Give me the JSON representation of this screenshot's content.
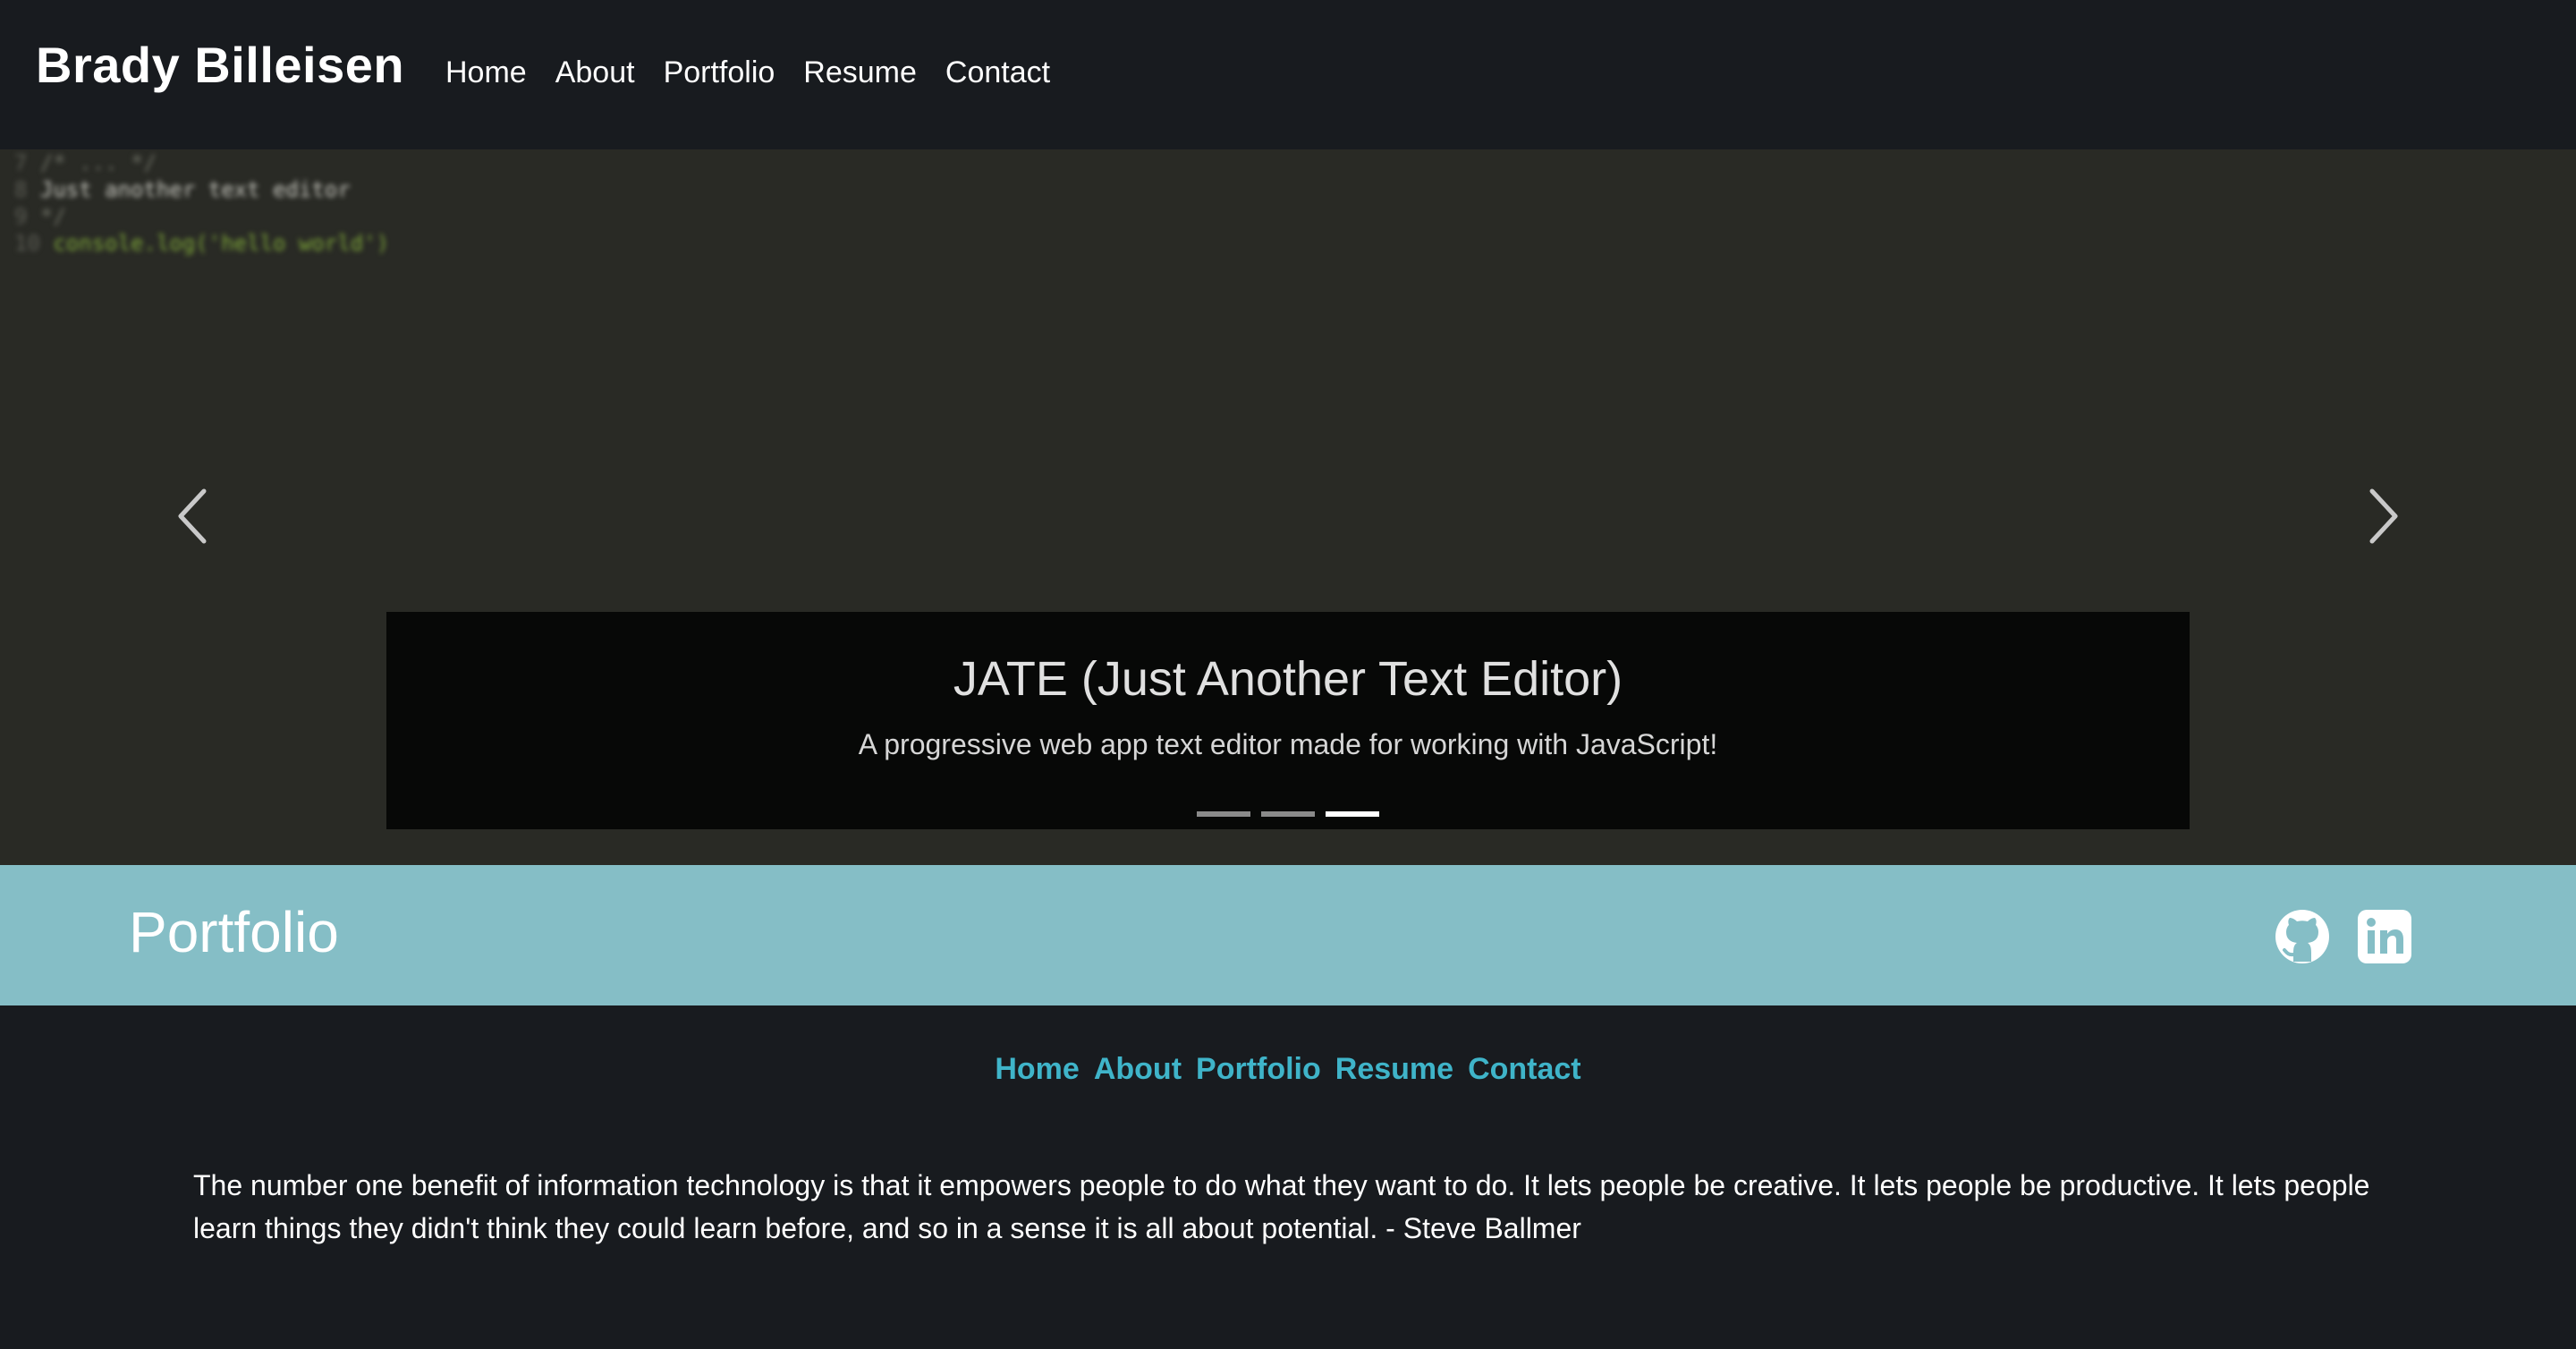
{
  "header": {
    "brand": "Brady Billeisen",
    "nav": [
      "Home",
      "About",
      "Portfolio",
      "Resume",
      "Contact"
    ]
  },
  "hero": {
    "code_lines": [
      {
        "num": "7",
        "text": "/* ... */"
      },
      {
        "num": "8",
        "text": "Just another text editor"
      },
      {
        "num": "9",
        "text": "*/"
      },
      {
        "num": "10",
        "text": "console.log('hello world')"
      }
    ],
    "slide": {
      "title": "JATE (Just Another Text Editor)",
      "description": "A progressive web app text editor made for working with JavaScript!"
    },
    "slide_count": 3,
    "active_slide": 3,
    "prev_icon": "chevron-left-icon",
    "next_icon": "chevron-right-icon"
  },
  "portfolio": {
    "title": "Portfolio",
    "social_icons": [
      "github-icon",
      "linkedin-icon"
    ]
  },
  "footer": {
    "nav": [
      "Home",
      "About",
      "Portfolio",
      "Resume",
      "Contact"
    ],
    "quote": "The number one benefit of information technology is that it empowers people to do what they want to do. It lets people be creative. It lets people be productive. It lets people learn things they didn't think they could learn before, and so in a sense it is all about potential. - Steve Ballmer"
  },
  "colors": {
    "header_bg": "#181b1f",
    "hero_bg": "#292a25",
    "band_bg": "#85bec6",
    "footer_link": "#3fb4c9"
  }
}
